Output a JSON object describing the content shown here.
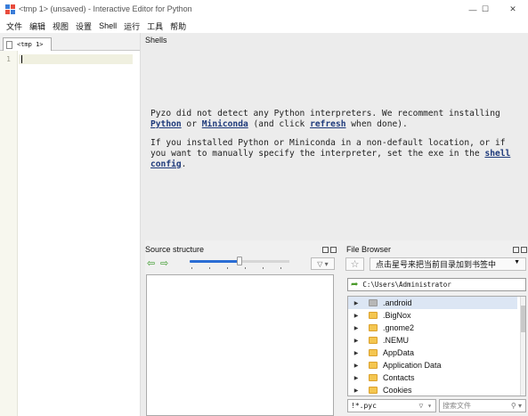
{
  "window": {
    "title": "<tmp 1> (unsaved) - Interactive Editor for Python",
    "minimize": "—",
    "maximize": "☐",
    "close": "✕"
  },
  "menu": [
    "文件",
    "编辑",
    "视图",
    "设置",
    "Shell",
    "运行",
    "工具",
    "帮助"
  ],
  "editor": {
    "tab_label": "<tmp 1>",
    "line_number": "1"
  },
  "shells": {
    "title": "Shells",
    "msg1_a": "Pyzo did not detect any Python interpreters. We recomment installing ",
    "link_python": "Python",
    "msg1_b": " or ",
    "link_miniconda": "Miniconda",
    "msg1_c": " (and click ",
    "link_refresh": "refresh",
    "msg1_d": " when done).",
    "msg2_a": "If you installed Python or Miniconda in a non-default location, or if you want to manually specify the interpreter, set the exe in the ",
    "link_config": "shell config",
    "msg2_b": "."
  },
  "source_structure": {
    "title": "Source structure",
    "back_icon": "⇦",
    "forward_icon": "⇨",
    "slider_value": 0.5,
    "filter_icon": "▽ ▾"
  },
  "file_browser": {
    "title": "File Browser",
    "star_icon": "☆",
    "bookmark_label": "点击星号来把当前目录加到书签中",
    "bookmark_arrow": "▼",
    "path": "C:\\Users\\Administrator",
    "items": [
      {
        "name": ".android",
        "selected": true,
        "folder_color": "grey"
      },
      {
        "name": ".BigNox",
        "selected": false,
        "folder_color": "yellow"
      },
      {
        "name": ".gnome2",
        "selected": false,
        "folder_color": "yellow"
      },
      {
        "name": ".NEMU",
        "selected": false,
        "folder_color": "yellow"
      },
      {
        "name": "AppData",
        "selected": false,
        "folder_color": "yellow"
      },
      {
        "name": "Application Data",
        "selected": false,
        "folder_color": "yellow"
      },
      {
        "name": "Contacts",
        "selected": false,
        "folder_color": "yellow"
      },
      {
        "name": "Cookies",
        "selected": false,
        "folder_color": "yellow"
      }
    ],
    "filter_value": "!*.pyc",
    "search_placeholder": "搜索文件"
  },
  "colors": {
    "link": "#1e3a7b",
    "slider_accent": "#2a6dd4",
    "selection": "#dce6f4",
    "folder": "#f4c650"
  }
}
